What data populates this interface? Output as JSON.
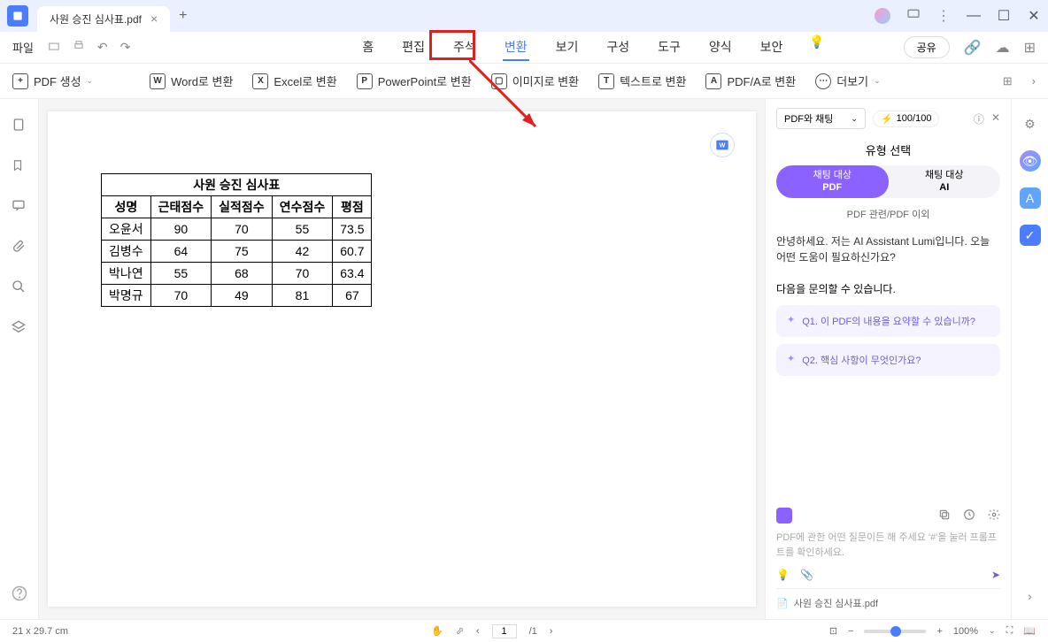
{
  "titlebar": {
    "tab_name": "사원 승진 심사표.pdf",
    "add_tab": "+"
  },
  "menubar": {
    "file": "파일",
    "items": [
      "홈",
      "편집",
      "주석",
      "변환",
      "보기",
      "구성",
      "도구",
      "양식",
      "보안"
    ],
    "share": "공유"
  },
  "toolbar": {
    "create_pdf": "PDF 생성",
    "to_word": "Word로 변환",
    "to_excel": "Excel로 변환",
    "to_ppt": "PowerPoint로 변환",
    "to_image": "이미지로 변환",
    "to_text": "텍스트로 변환",
    "to_pdfa": "PDF/A로 변환",
    "more": "더보기"
  },
  "document": {
    "table_title": "사원 승진 심사표",
    "headers": [
      "성명",
      "근태점수",
      "실적점수",
      "연수점수",
      "평점"
    ],
    "rows": [
      [
        "오윤서",
        "90",
        "70",
        "55",
        "73.5"
      ],
      [
        "김병수",
        "64",
        "75",
        "42",
        "60.7"
      ],
      [
        "박나연",
        "55",
        "68",
        "70",
        "63.4"
      ],
      [
        "박명규",
        "70",
        "49",
        "81",
        "67"
      ]
    ]
  },
  "chat": {
    "dropdown": "PDF와 채팅",
    "badge": "100/100",
    "type_title": "유형 선택",
    "tab_pdf_line1": "채팅 대상",
    "tab_pdf_line2": "PDF",
    "tab_ai_line1": "채팅 대상",
    "tab_ai_line2": "AI",
    "sub_label": "PDF 관련/PDF 이외",
    "greeting": "안녕하세요. 저는 AI Assistant Lumi입니다. 오늘 어떤 도움이 필요하신가요?",
    "suggest_title": "다음을 문의할 수 있습니다.",
    "q1": "Q1. 이 PDF의 내용을 요약할 수 있습니까?",
    "q2": "Q2. 핵심 사항이 무엇인가요?",
    "placeholder": "PDF에 관한 어떤 질문이든 해 주세요 '#'을 눌러 프롬프트를 확인하세요.",
    "file_ref": "사원 승진 심사표.pdf"
  },
  "statusbar": {
    "dimensions": "21 x 29.7 cm",
    "page_current": "1",
    "page_total": "/1",
    "zoom": "100%"
  }
}
